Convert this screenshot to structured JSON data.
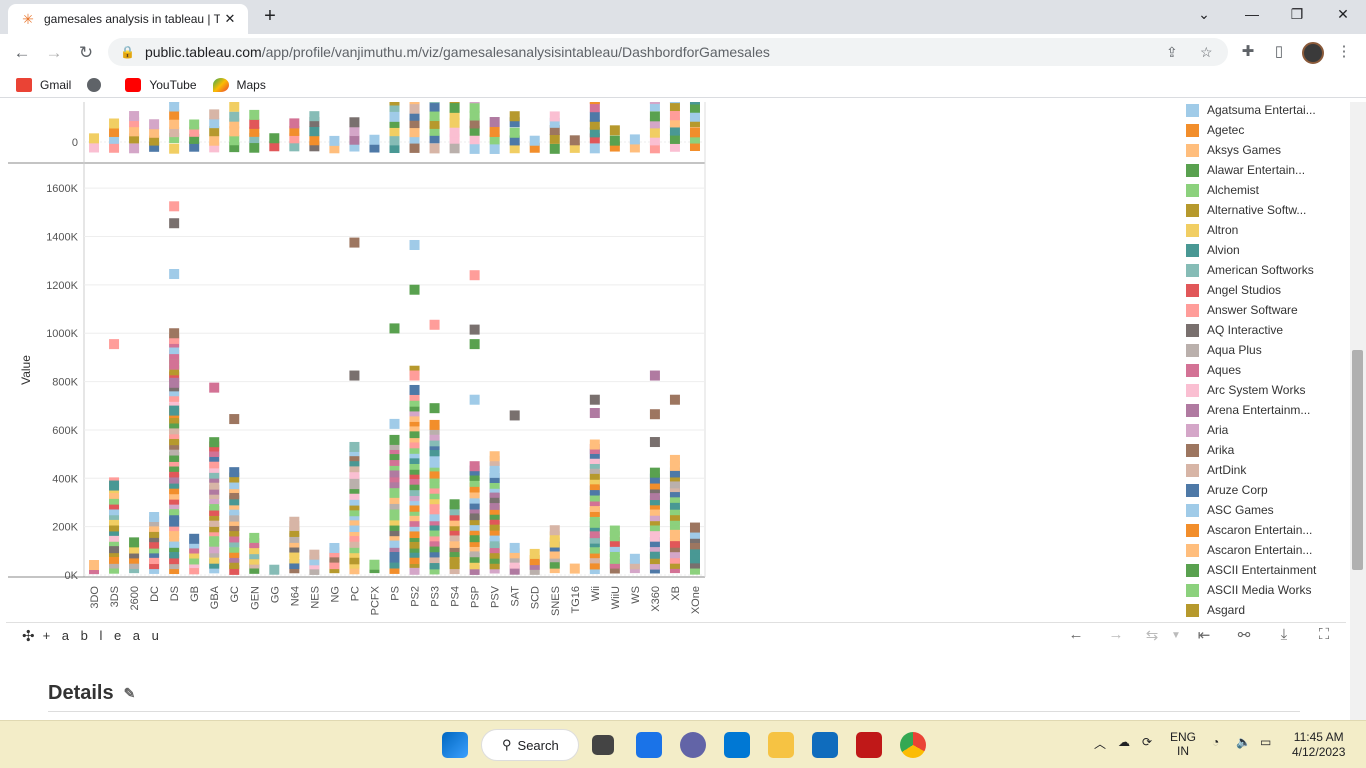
{
  "browser": {
    "tab_title": "gamesales analysis in tableau | Ta",
    "url_host": "public.tableau.com",
    "url_path": "/app/profile/vanjimuthu.m/viz/gamesalesanalysisintableau/DashbordforGamesales"
  },
  "bookmarks": [
    {
      "label": "Gmail",
      "color": "#ea4335"
    },
    {
      "label": "",
      "color": "#5f6368"
    },
    {
      "label": "YouTube",
      "color": "#ff0000"
    },
    {
      "label": "Maps",
      "color": "#34a853"
    }
  ],
  "chart_data": {
    "type": "scatter",
    "ylabel": "Value",
    "yticks": [
      "0K",
      "200K",
      "400K",
      "600K",
      "800K",
      "1000K",
      "1200K",
      "1400K",
      "1600K"
    ],
    "top_panel_ytick": "0",
    "categories": [
      "3DO",
      "3DS",
      "2600",
      "DC",
      "DS",
      "GB",
      "GBA",
      "GC",
      "GEN",
      "GG",
      "N64",
      "NES",
      "NG",
      "PC",
      "PCFX",
      "PS",
      "PS2",
      "PS3",
      "PS4",
      "PSP",
      "PSV",
      "SAT",
      "SCD",
      "SNES",
      "TG16",
      "Wii",
      "WiiU",
      "WS",
      "X360",
      "XB",
      "XOne"
    ],
    "outliers": [
      {
        "category": "3DS",
        "value": 955000,
        "color": "#ff9d9a"
      },
      {
        "category": "3DS",
        "value": 370000,
        "color": "#499894"
      },
      {
        "category": "DS",
        "value": 1525000,
        "color": "#ff9d9a"
      },
      {
        "category": "DS",
        "value": 1455000,
        "color": "#79706e"
      },
      {
        "category": "DS",
        "value": 1245000,
        "color": "#a0cbe8"
      },
      {
        "category": "DS",
        "value": 870000,
        "color": "#d37295"
      },
      {
        "category": "DS",
        "value": 795000,
        "color": "#b07aa1"
      },
      {
        "category": "DS",
        "value": 680000,
        "color": "#499894"
      },
      {
        "category": "GBA",
        "value": 775000,
        "color": "#d37295"
      },
      {
        "category": "GC",
        "value": 645000,
        "color": "#9d7660"
      },
      {
        "category": "PC",
        "value": 1375000,
        "color": "#9d7660"
      },
      {
        "category": "PC",
        "value": 825000,
        "color": "#79706e"
      },
      {
        "category": "PS",
        "value": 1020000,
        "color": "#59a14f"
      },
      {
        "category": "PS",
        "value": 625000,
        "color": "#a0cbe8"
      },
      {
        "category": "PS2",
        "value": 1365000,
        "color": "#a0cbe8"
      },
      {
        "category": "PS2",
        "value": 1180000,
        "color": "#59a14f"
      },
      {
        "category": "PS2",
        "value": 845000,
        "color": "#b6992d"
      },
      {
        "category": "PS2",
        "value": 825000,
        "color": "#ff9d9a"
      },
      {
        "category": "PS3",
        "value": 1035000,
        "color": "#ff9d9a"
      },
      {
        "category": "PS3",
        "value": 690000,
        "color": "#59a14f"
      },
      {
        "category": "PSP",
        "value": 1240000,
        "color": "#ff9d9a"
      },
      {
        "category": "PSP",
        "value": 1015000,
        "color": "#79706e"
      },
      {
        "category": "PSP",
        "value": 955000,
        "color": "#59a14f"
      },
      {
        "category": "PSP",
        "value": 725000,
        "color": "#a0cbe8"
      },
      {
        "category": "SAT",
        "value": 660000,
        "color": "#79706e"
      },
      {
        "category": "Wii",
        "value": 725000,
        "color": "#79706e"
      },
      {
        "category": "Wii",
        "value": 670000,
        "color": "#b07aa1"
      },
      {
        "category": "X360",
        "value": 825000,
        "color": "#b07aa1"
      },
      {
        "category": "X360",
        "value": 665000,
        "color": "#9d7660"
      },
      {
        "category": "X360",
        "value": 550000,
        "color": "#79706e"
      },
      {
        "category": "XB",
        "value": 725000,
        "color": "#9d7660"
      }
    ],
    "stack_tops": [
      40000,
      380000,
      130000,
      240000,
      1000000,
      150000,
      550000,
      420000,
      150000,
      30000,
      220000,
      80000,
      110000,
      530000,
      40000,
      560000,
      760000,
      620000,
      290000,
      450000,
      490000,
      110000,
      80000,
      180000,
      30000,
      540000,
      180000,
      60000,
      420000,
      470000,
      190000
    ],
    "top_panel_heights": [
      2,
      4,
      5,
      4,
      9,
      4,
      5,
      6,
      5,
      2,
      4,
      5,
      2,
      4,
      2,
      9,
      9,
      9,
      9,
      8,
      4,
      5,
      2,
      5,
      2,
      9,
      3,
      2,
      9,
      7,
      7
    ],
    "legend_title_hidden": true
  },
  "legend": [
    {
      "label": "Agatsuma Entertai...",
      "color": "#a0cbe8"
    },
    {
      "label": "Agetec",
      "color": "#f28e2b"
    },
    {
      "label": "Aksys Games",
      "color": "#ffbe7d"
    },
    {
      "label": "Alawar Entertain...",
      "color": "#59a14f"
    },
    {
      "label": "Alchemist",
      "color": "#8cd17d"
    },
    {
      "label": "Alternative Softw...",
      "color": "#b6992d"
    },
    {
      "label": "Altron",
      "color": "#f1ce63"
    },
    {
      "label": "Alvion",
      "color": "#499894"
    },
    {
      "label": "American Softworks",
      "color": "#86bcb6"
    },
    {
      "label": "Angel Studios",
      "color": "#e15759"
    },
    {
      "label": "Answer Software",
      "color": "#ff9d9a"
    },
    {
      "label": "AQ Interactive",
      "color": "#79706e"
    },
    {
      "label": "Aqua Plus",
      "color": "#bab0ac"
    },
    {
      "label": "Aques",
      "color": "#d37295"
    },
    {
      "label": "Arc System Works",
      "color": "#fabfd2"
    },
    {
      "label": "Arena Entertainm...",
      "color": "#b07aa1"
    },
    {
      "label": "Aria",
      "color": "#d4a6c8"
    },
    {
      "label": "Arika",
      "color": "#9d7660"
    },
    {
      "label": "ArtDink",
      "color": "#d7b5a6"
    },
    {
      "label": "Aruze Corp",
      "color": "#4e79a7"
    },
    {
      "label": "ASC Games",
      "color": "#a0cbe8"
    },
    {
      "label": "Ascaron Entertain...",
      "color": "#f28e2b"
    },
    {
      "label": "Ascaron Entertain...",
      "color": "#ffbe7d"
    },
    {
      "label": "ASCII Entertainment",
      "color": "#59a14f"
    },
    {
      "label": "ASCII Media Works",
      "color": "#8cd17d"
    },
    {
      "label": "Asgard",
      "color": "#b6992d"
    }
  ],
  "tableau_footer": {
    "logo": "+ a b l e a u"
  },
  "details": {
    "title": "Details"
  },
  "taskbar": {
    "search_label": "Search",
    "lang_top": "ENG",
    "lang_bottom": "IN",
    "time": "11:45 AM",
    "date": "4/12/2023"
  }
}
